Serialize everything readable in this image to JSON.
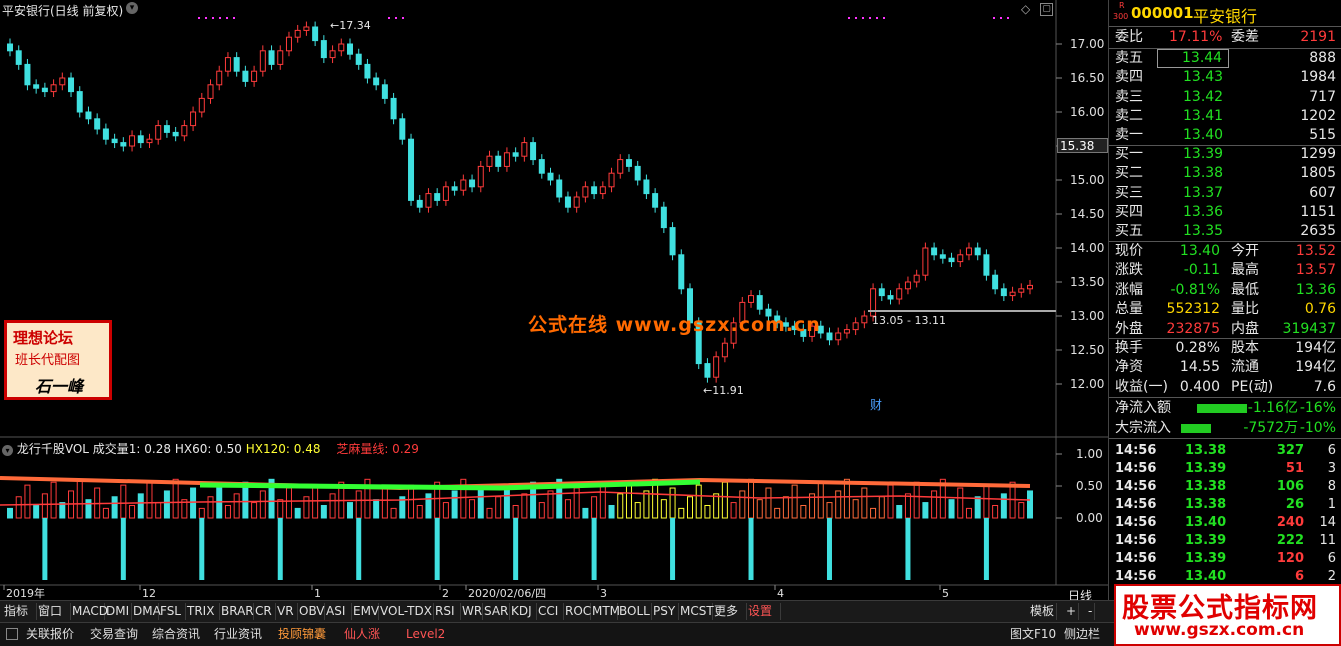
{
  "chart": {
    "title": "平安银行(日线 前复权)",
    "price_axis": [
      "17.00",
      "16.50",
      "16.00",
      "15.50",
      "15.00",
      "14.50",
      "14.00",
      "13.50",
      "13.00",
      "12.50",
      "12.00"
    ],
    "current_price_tag": "15.38",
    "high_label": "17.34",
    "low_label": "11.91",
    "range_label": "13.05 - 13.11",
    "caifu_mark": "财",
    "site_watermark": "公式在线 www.gszx.com.cn",
    "indicator_header": {
      "name": "龙行千股VOL",
      "v1": "成交量1: 0.28",
      "v2": "HX60: 0.50",
      "v3": "HX120: 0.48",
      "v4": "芝麻量线: 0.29"
    },
    "indicator_axis": [
      "1.00",
      "0.50",
      "0.00"
    ],
    "time_axis": [
      "2019年",
      "12",
      "1",
      "2",
      "2020/02/06/四",
      "3",
      "4",
      "5"
    ],
    "period_label": "日线",
    "colors": {
      "up": "#ff3b3b",
      "down": "#40e0e0",
      "yellow": "#ffff33",
      "green": "#33ff33",
      "orange": "#ff6a3a"
    }
  },
  "forum_stamp": {
    "line1": "理想论坛",
    "line2": "班长代配图",
    "line3": "石一峰"
  },
  "quote": {
    "code": "000001",
    "name": "平安银行",
    "badge_r": "R",
    "badge_num": "300",
    "weibi_label": "委比",
    "weibi": "17.11%",
    "weicha_label": "委差",
    "weicha": "2191",
    "sells": [
      {
        "label": "卖五",
        "price": "13.44",
        "vol": "888"
      },
      {
        "label": "卖四",
        "price": "13.43",
        "vol": "1984"
      },
      {
        "label": "卖三",
        "price": "13.42",
        "vol": "717"
      },
      {
        "label": "卖二",
        "price": "13.41",
        "vol": "1202"
      },
      {
        "label": "卖一",
        "price": "13.40",
        "vol": "515"
      }
    ],
    "buys": [
      {
        "label": "买一",
        "price": "13.39",
        "vol": "1299"
      },
      {
        "label": "买二",
        "price": "13.38",
        "vol": "1805"
      },
      {
        "label": "买三",
        "price": "13.37",
        "vol": "607"
      },
      {
        "label": "买四",
        "price": "13.36",
        "vol": "1151"
      },
      {
        "label": "买五",
        "price": "13.35",
        "vol": "2635"
      }
    ],
    "stats": [
      {
        "l1": "现价",
        "v1": "13.40",
        "l2": "今开",
        "v2": "13.52"
      },
      {
        "l1": "涨跌",
        "v1": "-0.11",
        "l2": "最高",
        "v2": "13.57"
      },
      {
        "l1": "涨幅",
        "v1": "-0.81%",
        "l2": "最低",
        "v2": "13.36"
      },
      {
        "l1": "总量",
        "v1": "552312",
        "l2": "量比",
        "v2": "0.76"
      },
      {
        "l1": "外盘",
        "v1": "232875",
        "l2": "内盘",
        "v2": "319437"
      }
    ],
    "stats2": [
      {
        "l1": "换手",
        "v1": "0.28%",
        "l2": "股本",
        "v2": "194亿"
      },
      {
        "l1": "净资",
        "v1": "14.55",
        "l2": "流通",
        "v2": "194亿"
      },
      {
        "l1": "收益(一)",
        "v1": "0.400",
        "l2": "PE(动)",
        "v2": "7.6"
      }
    ],
    "flows": [
      {
        "label": "净流入额",
        "value": "-1.16亿",
        "pct": "-16%"
      },
      {
        "label": "大宗流入",
        "value": "-7572万",
        "pct": "-10%"
      }
    ],
    "ticks": [
      {
        "t": "14:56",
        "p": "13.38",
        "v": "327",
        "n": "6"
      },
      {
        "t": "14:56",
        "p": "13.39",
        "v": "51",
        "n": "3"
      },
      {
        "t": "14:56",
        "p": "13.38",
        "v": "106",
        "n": "8"
      },
      {
        "t": "14:56",
        "p": "13.38",
        "v": "26",
        "n": "1"
      },
      {
        "t": "14:56",
        "p": "13.40",
        "v": "240",
        "n": "14"
      },
      {
        "t": "14:56",
        "p": "13.39",
        "v": "222",
        "n": "11"
      },
      {
        "t": "14:56",
        "p": "13.39",
        "v": "120",
        "n": "6"
      },
      {
        "t": "14:56",
        "p": "13.40",
        "v": "6",
        "n": "2"
      }
    ]
  },
  "toolbar": [
    "指标",
    "窗口",
    "MACD",
    "DMI",
    "DMA",
    "FSL",
    "TRIX",
    "BRAR",
    "CR",
    "VR",
    "OBV",
    "ASI",
    "EMV",
    "VOL-TDX",
    "RSI",
    "WR",
    "SAR",
    "KDJ",
    "CCI",
    "ROC",
    "MTM",
    "BOLL",
    "PSY",
    "MCST",
    "更多",
    "设置"
  ],
  "toolbar_right": [
    "模板",
    "+",
    "-"
  ],
  "bottom_tabs": [
    "关联报价",
    "交易查询",
    "综合资讯",
    "行业资讯",
    "投顾锦囊",
    "仙人涨",
    "Level2"
  ],
  "bottom_right": [
    "图文F10",
    "侧边栏"
  ],
  "ad_watermark": {
    "line1": "股票公式指标网",
    "line2": "www.gszx.com.cn"
  }
}
